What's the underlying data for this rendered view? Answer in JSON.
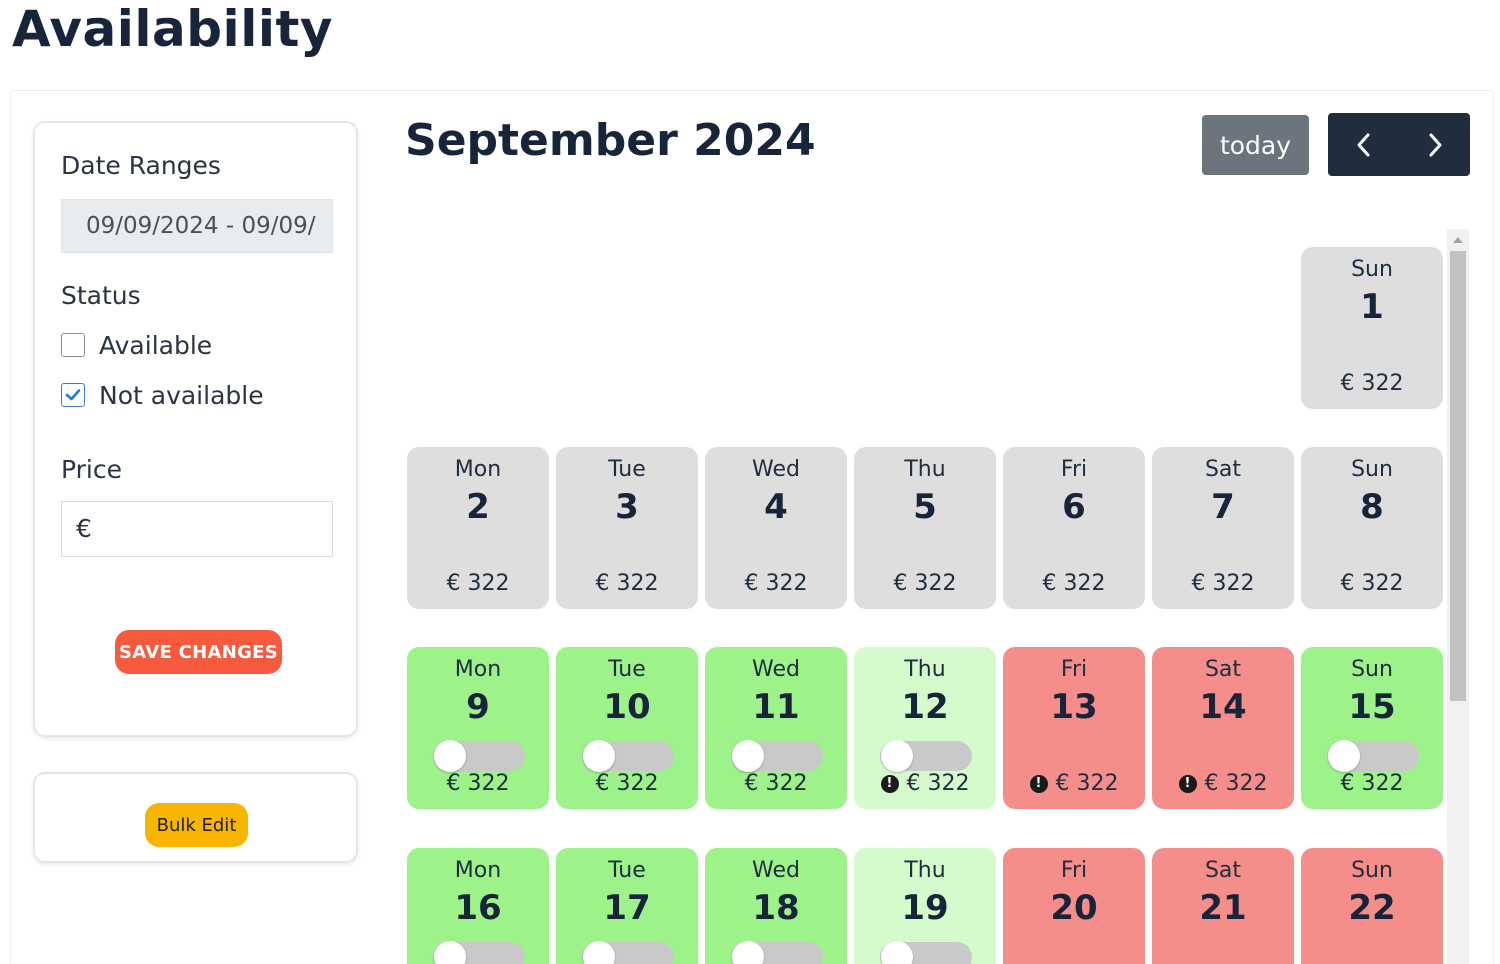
{
  "page": {
    "title": "Availability"
  },
  "filters": {
    "date_ranges_label": "Date Ranges",
    "date_range_value": "09/09/2024 - 09/09/",
    "status_label": "Status",
    "status_options": [
      {
        "label": "Available",
        "checked": false
      },
      {
        "label": "Not available",
        "checked": true
      }
    ],
    "price_label": "Price",
    "price_placeholder": "€",
    "save_label": "SAVE CHANGES"
  },
  "bulk": {
    "label": "Bulk Edit"
  },
  "calendar": {
    "month_title": "September 2024",
    "today_label": "today",
    "prev_icon": "chevron-left-icon",
    "next_icon": "chevron-right-icon",
    "colors": {
      "grey": "#dedede",
      "green": "#9df28a",
      "lightgreen": "#d5fbcc",
      "red": "#f58d8a"
    },
    "weeks": [
      [
        {
          "day": "Sun",
          "num": "1",
          "price": "€ 322",
          "status": "grey",
          "toggle": false,
          "warning": false
        }
      ],
      [
        {
          "day": "Mon",
          "num": "2",
          "price": "€ 322",
          "status": "grey",
          "toggle": false,
          "warning": false
        },
        {
          "day": "Tue",
          "num": "3",
          "price": "€ 322",
          "status": "grey",
          "toggle": false,
          "warning": false
        },
        {
          "day": "Wed",
          "num": "4",
          "price": "€ 322",
          "status": "grey",
          "toggle": false,
          "warning": false
        },
        {
          "day": "Thu",
          "num": "5",
          "price": "€ 322",
          "status": "grey",
          "toggle": false,
          "warning": false
        },
        {
          "day": "Fri",
          "num": "6",
          "price": "€ 322",
          "status": "grey",
          "toggle": false,
          "warning": false
        },
        {
          "day": "Sat",
          "num": "7",
          "price": "€ 322",
          "status": "grey",
          "toggle": false,
          "warning": false
        },
        {
          "day": "Sun",
          "num": "8",
          "price": "€ 322",
          "status": "grey",
          "toggle": false,
          "warning": false
        }
      ],
      [
        {
          "day": "Mon",
          "num": "9",
          "price": "€ 322",
          "status": "green",
          "toggle": true,
          "warning": false
        },
        {
          "day": "Tue",
          "num": "10",
          "price": "€ 322",
          "status": "green",
          "toggle": true,
          "warning": false
        },
        {
          "day": "Wed",
          "num": "11",
          "price": "€ 322",
          "status": "green",
          "toggle": true,
          "warning": false
        },
        {
          "day": "Thu",
          "num": "12",
          "price": "€ 322",
          "status": "lightgreen",
          "toggle": true,
          "warning": true
        },
        {
          "day": "Fri",
          "num": "13",
          "price": "€ 322",
          "status": "red",
          "toggle": false,
          "warning": true
        },
        {
          "day": "Sat",
          "num": "14",
          "price": "€ 322",
          "status": "red",
          "toggle": false,
          "warning": true
        },
        {
          "day": "Sun",
          "num": "15",
          "price": "€ 322",
          "status": "green",
          "toggle": true,
          "warning": false
        }
      ],
      [
        {
          "day": "Mon",
          "num": "16",
          "price": "",
          "status": "green",
          "toggle": true,
          "warning": false
        },
        {
          "day": "Tue",
          "num": "17",
          "price": "",
          "status": "green",
          "toggle": true,
          "warning": false
        },
        {
          "day": "Wed",
          "num": "18",
          "price": "",
          "status": "green",
          "toggle": true,
          "warning": false
        },
        {
          "day": "Thu",
          "num": "19",
          "price": "",
          "status": "lightgreen",
          "toggle": true,
          "warning": false
        },
        {
          "day": "Fri",
          "num": "20",
          "price": "",
          "status": "red",
          "toggle": false,
          "warning": false
        },
        {
          "day": "Sat",
          "num": "21",
          "price": "",
          "status": "red",
          "toggle": false,
          "warning": false
        },
        {
          "day": "Sun",
          "num": "22",
          "price": "",
          "status": "red",
          "toggle": false,
          "warning": false
        }
      ]
    ]
  }
}
